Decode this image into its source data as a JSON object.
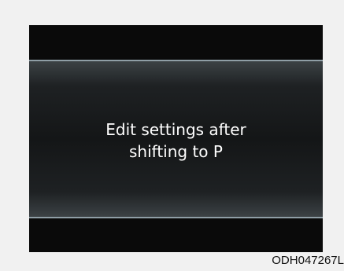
{
  "display": {
    "message_line1": "Edit settings after",
    "message_line2": "shifting to P"
  },
  "figure_code": "ODH047267L",
  "colors": {
    "screen_background": "#0c0c0c",
    "divider": "#8f9ea6",
    "message_text": "#ffffff",
    "page_background": "#f1f1f1"
  }
}
